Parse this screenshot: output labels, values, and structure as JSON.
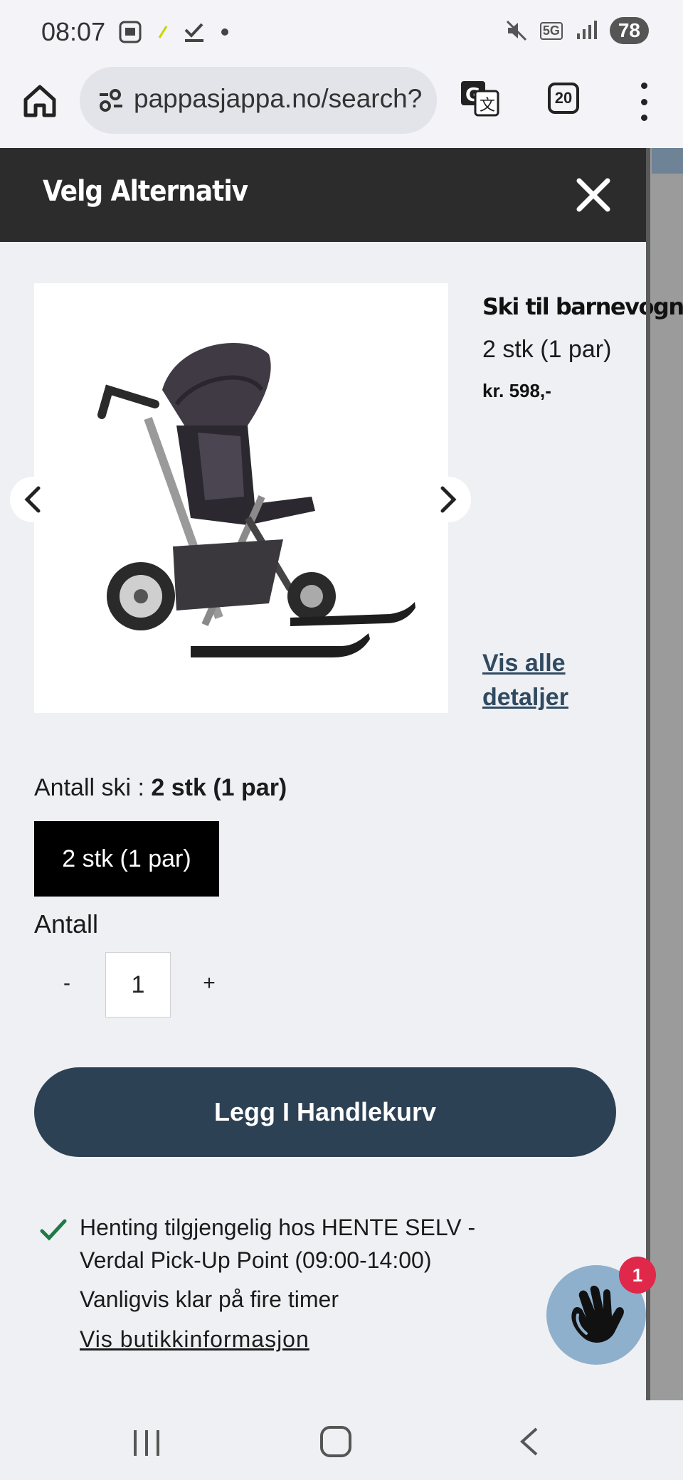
{
  "status_bar": {
    "time": "08:07",
    "network": "5G",
    "battery": "78",
    "icons": [
      "screenshot-icon",
      "leaf-icon",
      "check-download-icon",
      "dot-icon",
      "mute-icon",
      "signal-icon"
    ]
  },
  "browser": {
    "url": "pappasjappa.no/search?",
    "tab_count": "20",
    "icons": [
      "home-icon",
      "site-settings-icon",
      "translate-icon",
      "more-menu-icon"
    ]
  },
  "modal": {
    "title": "Velg Alternativ",
    "product": {
      "name": "Ski til barnevogn",
      "variant": "2 stk (1 par)",
      "price": "kr. 598,-",
      "details_link": "Vis alle detaljer"
    },
    "option": {
      "label": "Antall ski : ",
      "selected_value": "2 stk (1 par)",
      "button_label": "2 stk (1 par)"
    },
    "quantity": {
      "label": "Antall",
      "minus": "-",
      "value": "1",
      "plus": "+"
    },
    "add_to_cart": "Legg I Handlekurv",
    "pickup": {
      "availability": "Henting tilgjengelig hos HENTE SELV - Verdal Pick-Up Point (09:00-14:00)",
      "ready": "Vanligvis klar på fire timer",
      "store_link": "Vis butikkinformasjon"
    }
  },
  "chat": {
    "badge": "1"
  },
  "colors": {
    "header": "#2c2c2c",
    "cart_button": "#2d4154",
    "link": "#2f4a61",
    "check": "#1e7a46",
    "chat": "#8eb0cc",
    "badge": "#e0284a"
  }
}
